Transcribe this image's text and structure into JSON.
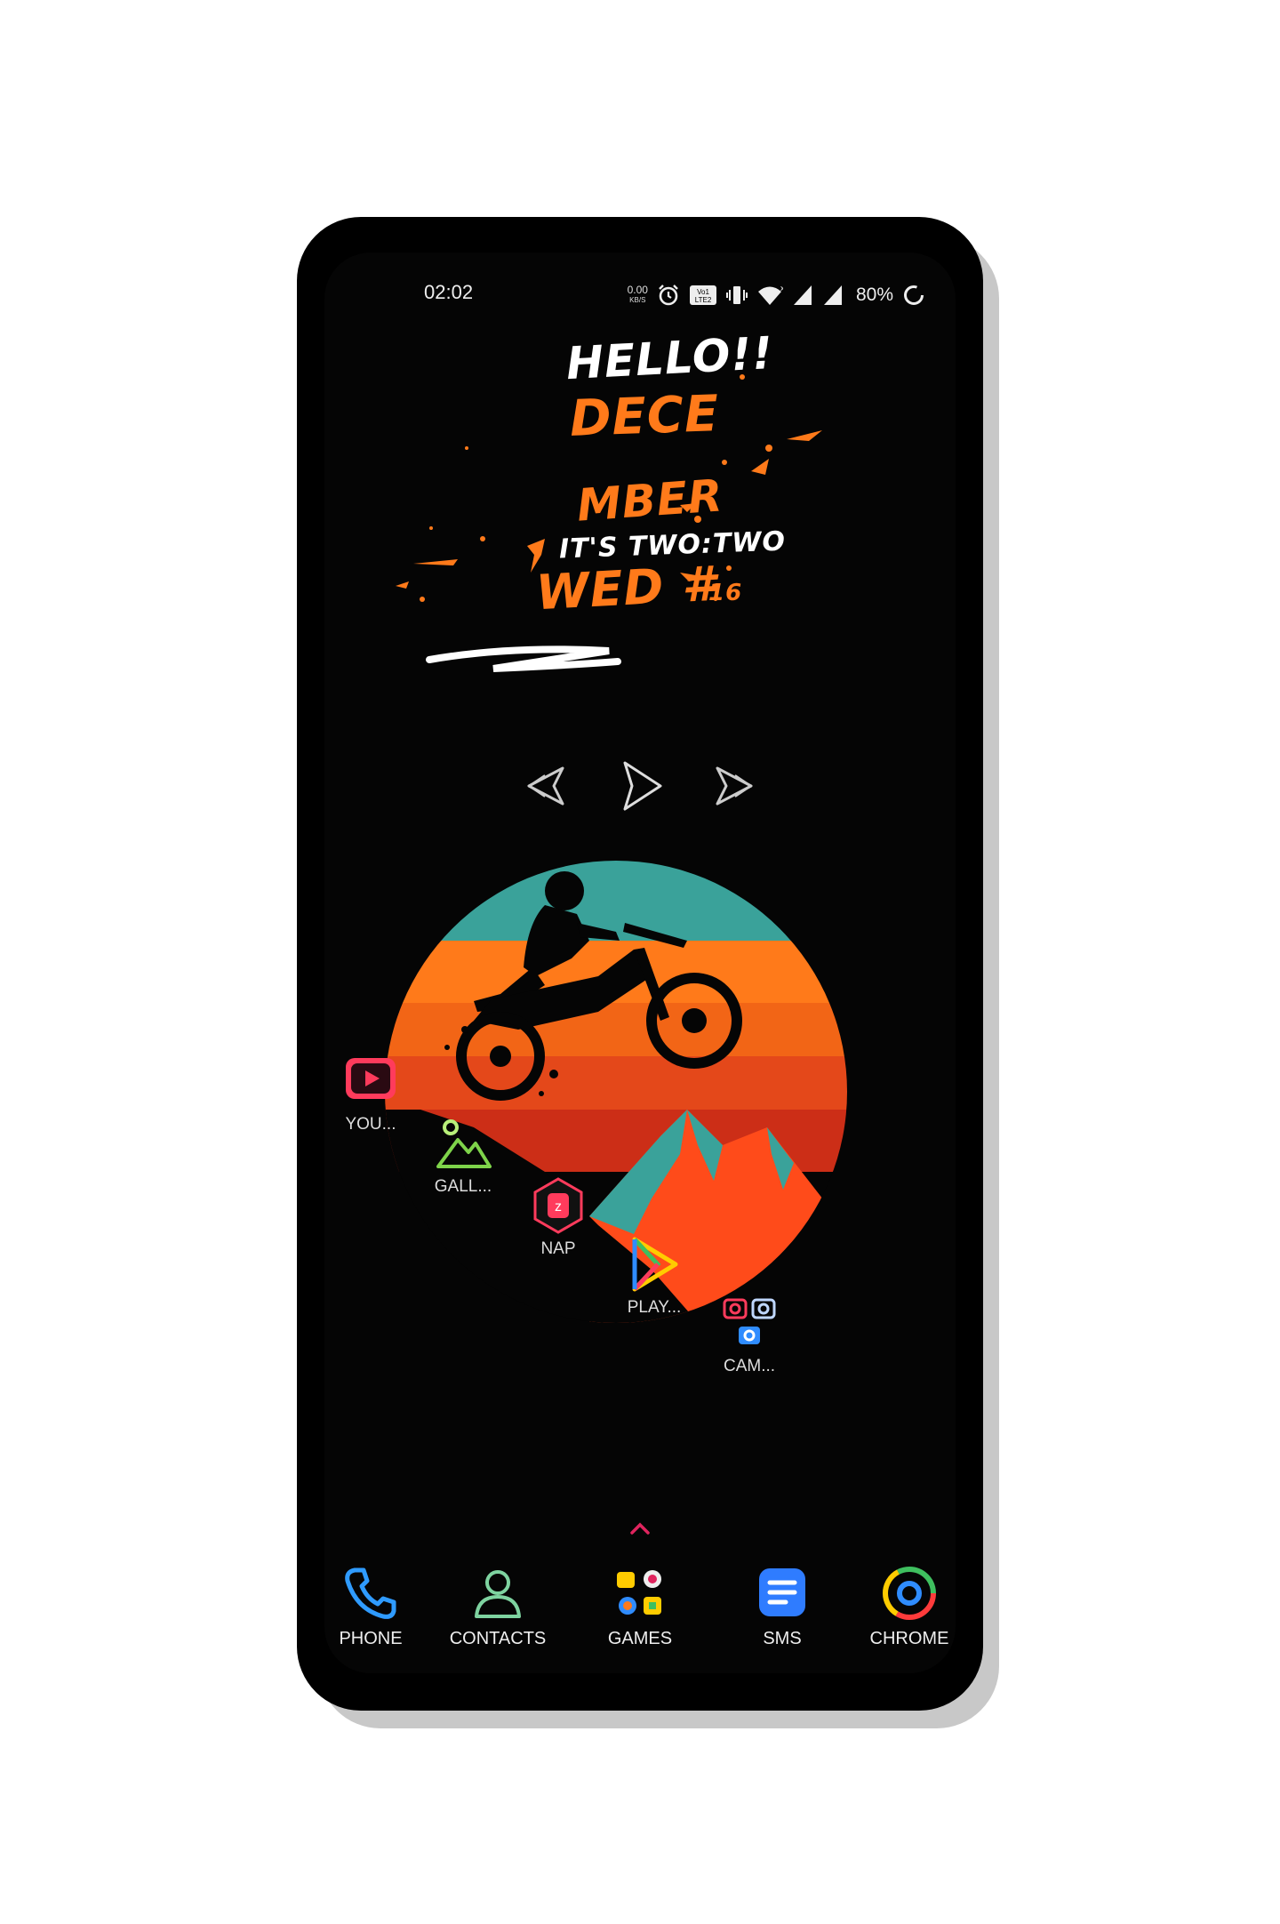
{
  "status_bar": {
    "time": "02:02",
    "net_speed": "0.00",
    "net_unit": "KB/S",
    "volte": "Vo LTE",
    "battery": "80%"
  },
  "widget": {
    "line1": "HELLO!!",
    "line2": "DECE",
    "line3": "MBER",
    "line4": "IT'S TWO:TWO",
    "line5": "WED #",
    "line6": "16"
  },
  "media_controls": {
    "prev": "previous-icon",
    "play": "play-icon",
    "next": "next-icon"
  },
  "home_apps": [
    {
      "label": "YOU...",
      "icon": "youtube-icon"
    },
    {
      "label": "GALL...",
      "icon": "gallery-icon"
    },
    {
      "label": "NAP",
      "icon": "nap-icon"
    },
    {
      "label": "PLAY...",
      "icon": "play-store-icon"
    },
    {
      "label": "CAM...",
      "icon": "camera-folder-icon"
    }
  ],
  "dock": [
    {
      "label": "PHONE",
      "icon": "phone-icon"
    },
    {
      "label": "CONTACTS",
      "icon": "contacts-icon"
    },
    {
      "label": "GAMES",
      "icon": "games-folder-icon"
    },
    {
      "label": "SMS",
      "icon": "sms-icon"
    },
    {
      "label": "CHROME",
      "icon": "chrome-icon"
    }
  ],
  "colors": {
    "accent_orange": "#ff7a1a",
    "teal": "#3aa29a",
    "background": "#050505",
    "pink_arrow": "#e0245e"
  }
}
